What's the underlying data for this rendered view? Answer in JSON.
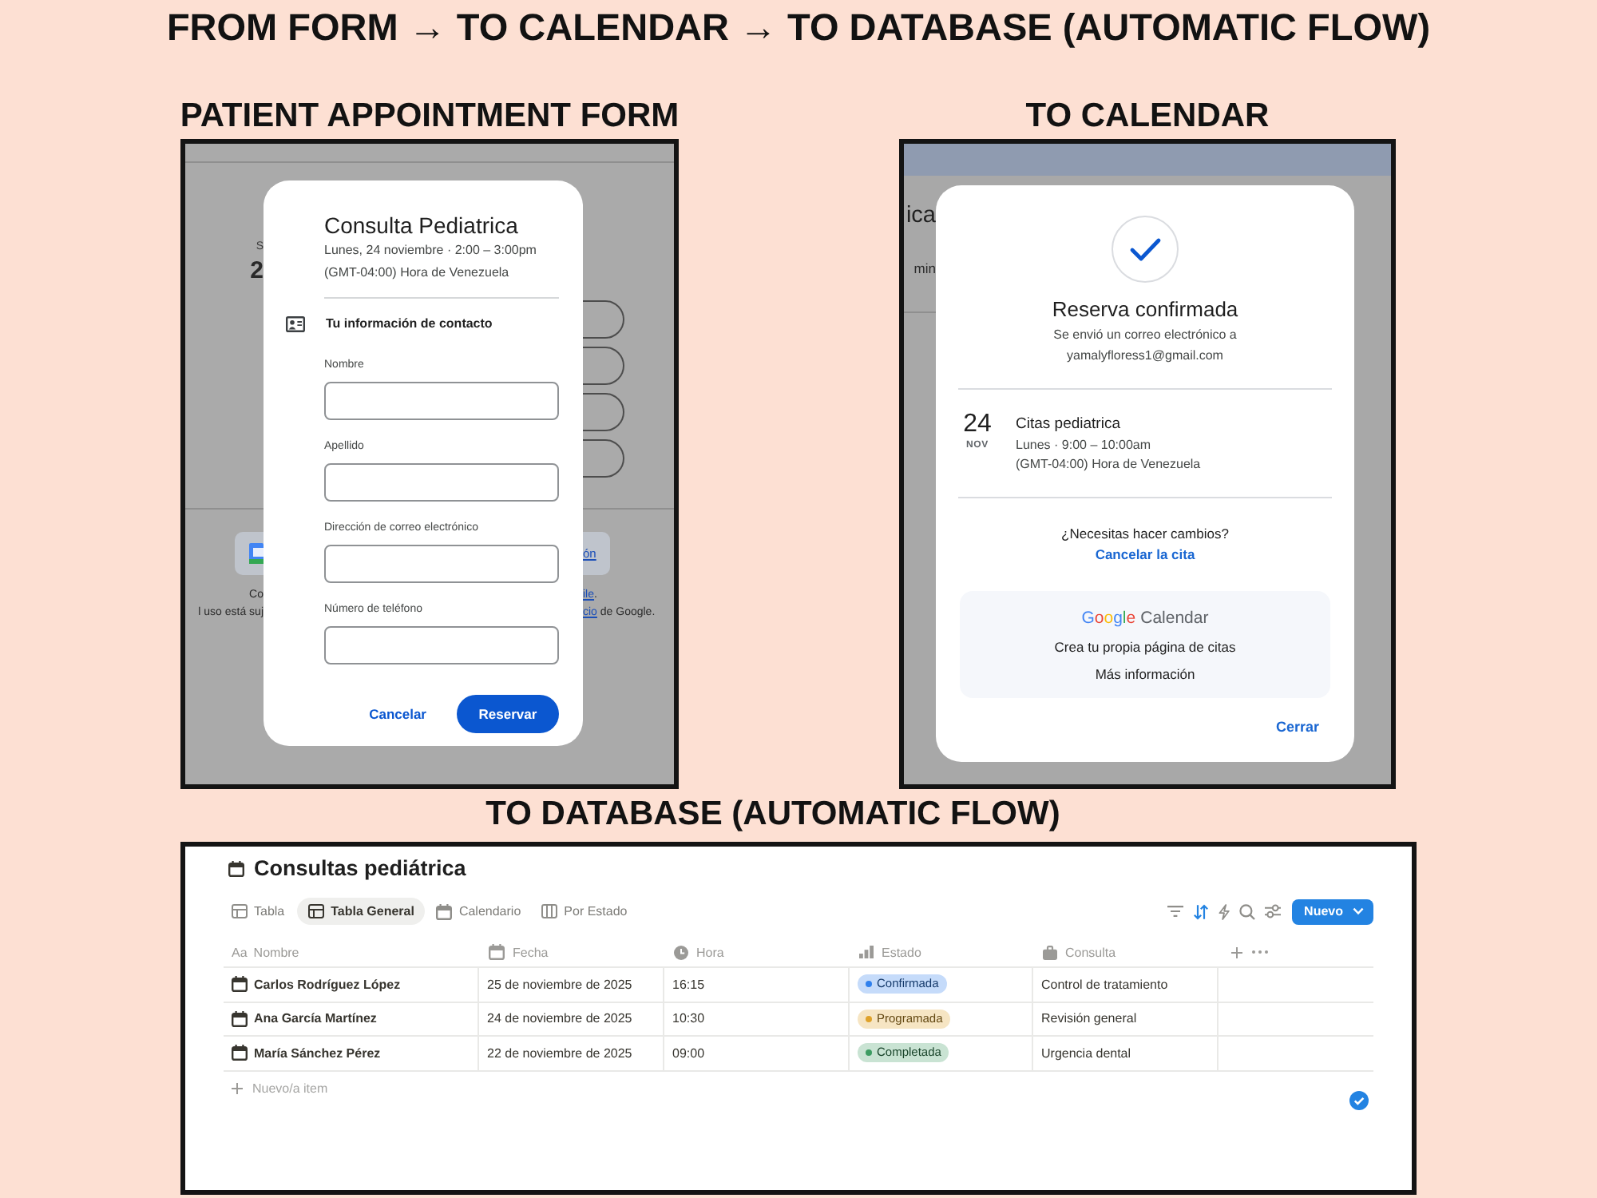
{
  "title": "FROM FORM → TO CALENDAR → TO DATABASE (AUTOMATIC FLOW)",
  "form_section": {
    "heading": "PATIENT APPOINTMENT FORM",
    "page_behind": {
      "header_letter": "S",
      "date_digit": "2",
      "button_link": "ón",
      "notice_left": [
        "Co",
        "l uso está suj"
      ],
      "notice_right": [
        {
          "link": "ile",
          "text": "."
        },
        {
          "link": "cio",
          "text": " de Google."
        }
      ]
    },
    "dialog": {
      "title": "Consulta Pediatrica",
      "when": "Lunes, 24 noviembre · 2:00 – 3:00pm",
      "timezone": "(GMT-04:00) Hora de Venezuela",
      "section_label": "Tu información de contacto",
      "fields": [
        {
          "label": "Nombre"
        },
        {
          "label": "Apellido"
        },
        {
          "label": "Dirección de correo electrónico"
        },
        {
          "label": "Número de teléfono"
        }
      ],
      "cancel": "Cancelar",
      "submit": "Reservar"
    }
  },
  "calendar_section": {
    "heading": "TO CALENDAR",
    "page_behind": {
      "title_end": "ica",
      "detail_end": "min"
    },
    "dialog": {
      "heading": "Reserva confirmada",
      "sent_to": "Se envió un correo electrónico a",
      "email": "yamalyfloress1@gmail.com",
      "event": {
        "day": "24",
        "month": "NOV",
        "title": "Citas pediatrica",
        "when": "Lunes · 9:00 – 10:00am",
        "timezone": "(GMT-04:00) Hora de Venezuela"
      },
      "change_prompt": "¿Necesitas hacer cambios?",
      "cancel_link": "Cancelar la cita",
      "promo": {
        "logo": {
          "brand": "Google",
          "product": "Calendar"
        },
        "text": "Crea tu propia página de citas",
        "link": "Más información"
      },
      "close": "Cerrar"
    }
  },
  "database_section": {
    "heading": "TO DATABASE (AUTOMATIC FLOW)",
    "title": "Consultas pediátrica",
    "views": [
      {
        "label": "Tabla",
        "kind": "table",
        "selected": false
      },
      {
        "label": "Tabla General",
        "kind": "table",
        "selected": true
      },
      {
        "label": "Calendario",
        "kind": "calendar",
        "selected": false
      },
      {
        "label": "Por Estado",
        "kind": "board",
        "selected": false
      }
    ],
    "toolbar": [
      {
        "kind": "filter",
        "active": false
      },
      {
        "kind": "sort",
        "active": true
      },
      {
        "kind": "automation",
        "active": false
      },
      {
        "kind": "search",
        "active": false
      },
      {
        "kind": "settings",
        "active": false
      }
    ],
    "new_button": "Nuevo",
    "columns": [
      {
        "label": "Nombre",
        "kind": "title",
        "glyph": "Aa"
      },
      {
        "label": "Fecha",
        "kind": "date"
      },
      {
        "label": "Hora",
        "kind": "time"
      },
      {
        "label": "Estado",
        "kind": "status"
      },
      {
        "label": "Consulta",
        "kind": "select"
      }
    ],
    "rows": [
      {
        "name": "Carlos Rodríguez López",
        "date": "25 de noviembre de 2025",
        "time": "16:15",
        "status": {
          "label": "Confirmada",
          "color": "#2f80ed"
        },
        "consulta": "Control de tratamiento"
      },
      {
        "name": "Ana García Martínez",
        "date": "24 de noviembre de 2025",
        "time": "10:30",
        "status": {
          "label": "Programada",
          "color": "#dfa22a"
        },
        "consulta": "Revisión general"
      },
      {
        "name": "María Sánchez Pérez",
        "date": "22 de noviembre de 2025",
        "time": "09:00",
        "status": {
          "label": "Completada",
          "color": "#3d9c62"
        },
        "consulta": "Urgencia dental"
      }
    ],
    "add_row": "Nuevo/a item"
  }
}
